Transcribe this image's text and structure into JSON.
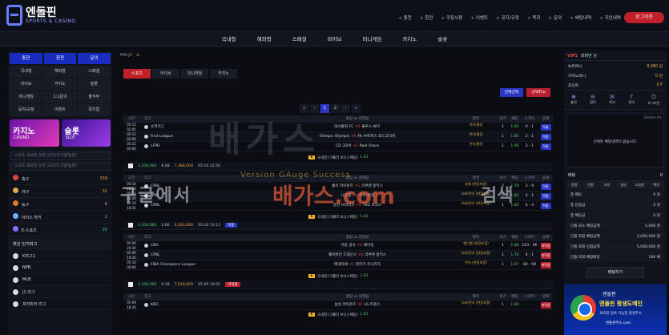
{
  "brand": {
    "name": "엔돌핀",
    "sub": "SPORTS & CASINO"
  },
  "topmenu": [
    "충전",
    "환전",
    "쿠폰사용",
    "이벤트",
    "공지/규정",
    "쪽지",
    "문의",
    "배팅내역",
    "지인내역"
  ],
  "login_label": "로그아웃",
  "mainnav": [
    "국내형",
    "해외형",
    "스페셜",
    "라이브",
    "미니게임",
    "카지노",
    "슬롯"
  ],
  "left": {
    "buttons": [
      "충전",
      "환전",
      "문의"
    ],
    "grid": [
      "국내형",
      "해외형",
      "스페셜",
      "라이브",
      "카지노",
      "슬롯",
      "미니게임",
      "1:1문의",
      "출석부",
      "공지/규정",
      "이벤트",
      "쪽지함"
    ],
    "banner_casino": "카지노",
    "banner_casino_sub": "CASINO",
    "banner_slot": "슬롯",
    "banner_slot_sub": "SLOT",
    "search1": "스포츠 국내형 검색 (국가/리그명/팀명)",
    "search2": "스포츠 해외형 검색 (국가/리그명/팀명)",
    "sports": [
      {
        "n": "축구",
        "c": "339"
      },
      {
        "n": "야구",
        "c": "31"
      },
      {
        "n": "농구",
        "c": "6"
      },
      {
        "n": "아이스 하키",
        "c": "2"
      },
      {
        "n": "E-스포츠",
        "c": "20"
      }
    ],
    "popular_title": "최신 인기리그",
    "leagues": [
      "K리그1",
      "NPB",
      "MLB",
      "J1 리그",
      "프리미어 리그"
    ]
  },
  "center": {
    "breadcrumb": "MA:JC",
    "tabs": [
      "스포츠",
      "라이브",
      "미니게임",
      "카지노"
    ],
    "pills": [
      "전체선택",
      "선택취소"
    ],
    "pager": [
      "«",
      "‹",
      "1",
      "2",
      "›",
      "»"
    ],
    "headers": [
      "시간",
      "리그",
      "홈팀 vs 원정팀",
      "항목",
      "보기",
      "배당",
      "스코어",
      "상태"
    ],
    "bonus_label": "국내형 [크롤러 보너스배당]",
    "bonus_value": "1.03",
    "blocks": [
      {
        "rows": [
          {
            "t": "05-11 02:05",
            "lg": "슈퍼리그",
            "m1": "대사통화 FC",
            "m2": "울루스 NFC",
            "o": "언더/결경",
            "n": "1",
            "odd": "1.85",
            "sc": "0 - 1",
            "st": "적중"
          },
          {
            "t": "05-11 02:00",
            "lg": "First League",
            "m1": "Olimpic Olympic",
            "m2": "FK 브트자스 포드고리자",
            "o": "언더/결경",
            "n": "1",
            "odd": "1.85",
            "sc": "2 - 1",
            "st": "적중"
          },
          {
            "t": "05-11 04:00",
            "lg": "LFPB",
            "m1": "CD 고0어",
            "m2": "Real Oruro",
            "o": "언더/결경",
            "n": "1",
            "odd": "1.95",
            "sc": "3 - 1",
            "st": "적중"
          }
        ],
        "sum": {
          "bet": "1,100,000",
          "odds": "6.68",
          "win": "7,388,000",
          "date": "05-10 22:56",
          "tag": ""
        }
      },
      {
        "rows": [
          {
            "t": "05-10 18:30",
            "lg": "CPBL",
            "m1": "통이 라이온즈",
            "m2": "라쿠텐 몽키스",
            "o": "승패 (연장포함)",
            "n": "2",
            "odd": "1.70",
            "sc": "3 - 9",
            "st": "적중"
          },
          {
            "t": "05-10 18:30",
            "lg": "NPB",
            "m1": "니혼햄",
            "m2": "지바 롯데",
            "o": "오버/언더 (연장포함)",
            "n": "1",
            "odd": "1.82",
            "sc": "4 - 1",
            "st": "적중"
          },
          {
            "t": "05-10 18:35",
            "lg": "CPBL",
            "m1": "중신 브라더스",
            "m2": "TSG 호크스",
            "o": "오버/언더 (연장포함)",
            "n": "1",
            "odd": "1.85",
            "sc": "6 - 4",
            "st": "적중"
          }
        ],
        "sum": {
          "bet": "1,100,000",
          "odds": "3.66",
          "win": "4,026,000",
          "date": "05-10 13:12",
          "tag": "적중"
        }
      },
      {
        "rows": [
          {
            "t": "05-09 20:30",
            "lg": "CBA",
            "m1": "저장 광사",
            "m2": "베이징",
            "o": "핸디캡 (연장포함)",
            "n": "1",
            "odd": "1.80",
            "sc": "103 - 96",
            "st": "미적중"
          },
          {
            "t": "05-09 19:35",
            "lg": "CPBL",
            "m1": "웨이취안 드래곤스",
            "m2": "라쿠텐 몽키스",
            "o": "오버/언더 (연장포함)",
            "n": "1",
            "odd": "1.76",
            "sc": "4 - 1",
            "st": "미적중"
          },
          {
            "t": "05-10 00:00",
            "lg": "FIBA Champions League",
            "m1": "테네리페",
            "m2": "말라가 유니카하",
            "o": "언더 (연장포함)",
            "n": "1",
            "odd": "1.87",
            "sc": "80 - 90",
            "st": "미적중"
          }
        ],
        "sum": {
          "bet": "1,100,000",
          "odds": "6.38",
          "win": "7,018,000",
          "date": "05-09 19:52",
          "tag": "미적중"
        }
      },
      {
        "rows": [
          {
            "t": "05-09 18:30",
            "lg": "KBO",
            "m1": "삼성 라이온즈",
            "m2": "LG 트윈스",
            "o": "오버/언더 (연장포함)",
            "n": "1",
            "odd": "1.80",
            "sc": "",
            "st": "미적중"
          }
        ],
        "sum": null
      }
    ]
  },
  "right": {
    "vip": "VIP1",
    "user": "파퍼먼 님",
    "balances": [
      {
        "n": "보유머니",
        "v": "8,080 원"
      },
      {
        "n": "카지노머니",
        "v": "0 원"
      },
      {
        "n": "포인트",
        "v": "0 P"
      }
    ],
    "icons": [
      "충전",
      "환전",
      "쪽지",
      "문의",
      "로그아웃"
    ],
    "delete_all": "Delete All",
    "slip_msg": "선택된 배팅내역이 없습니다.",
    "bet_title": "배팅",
    "bet_reset": "0",
    "amounts": [
      "정정",
      "만원",
      "오만",
      "십만",
      "오십만",
      "백만"
    ],
    "info": [
      {
        "n": "총 배당",
        "v": "0 원"
      },
      {
        "n": "총 당첨금",
        "v": "0 원"
      },
      {
        "n": "총 배당금",
        "v": "0 원"
      },
      {
        "n": "단폴 최소 배팅금액",
        "v": "5,000 원"
      },
      {
        "n": "단폴 최대 배팅금액",
        "v": "2,000,000 원"
      },
      {
        "n": "단폴 최대 당첨금액",
        "v": "5,000,000 원"
      },
      {
        "n": "단폴 최대 배팅배당",
        "v": "100 배"
      }
    ],
    "bet_btn": "배팅하기",
    "ad": {
      "t1": "엔돌핀",
      "t2": "엔돌핀 평생도메인",
      "t3": "365일 접속 가능한 평생주소",
      "t4": "엔돌핀주소.com"
    }
  },
  "watermark": {
    "big": "배가스",
    "sub": "Version GAuge Success",
    "left": "구글에서",
    "mid": "배가스.com",
    "right": "검색"
  },
  "colors": {
    "accent": "#2b37c6",
    "danger": "#c0202a",
    "win": "#57d26c"
  }
}
